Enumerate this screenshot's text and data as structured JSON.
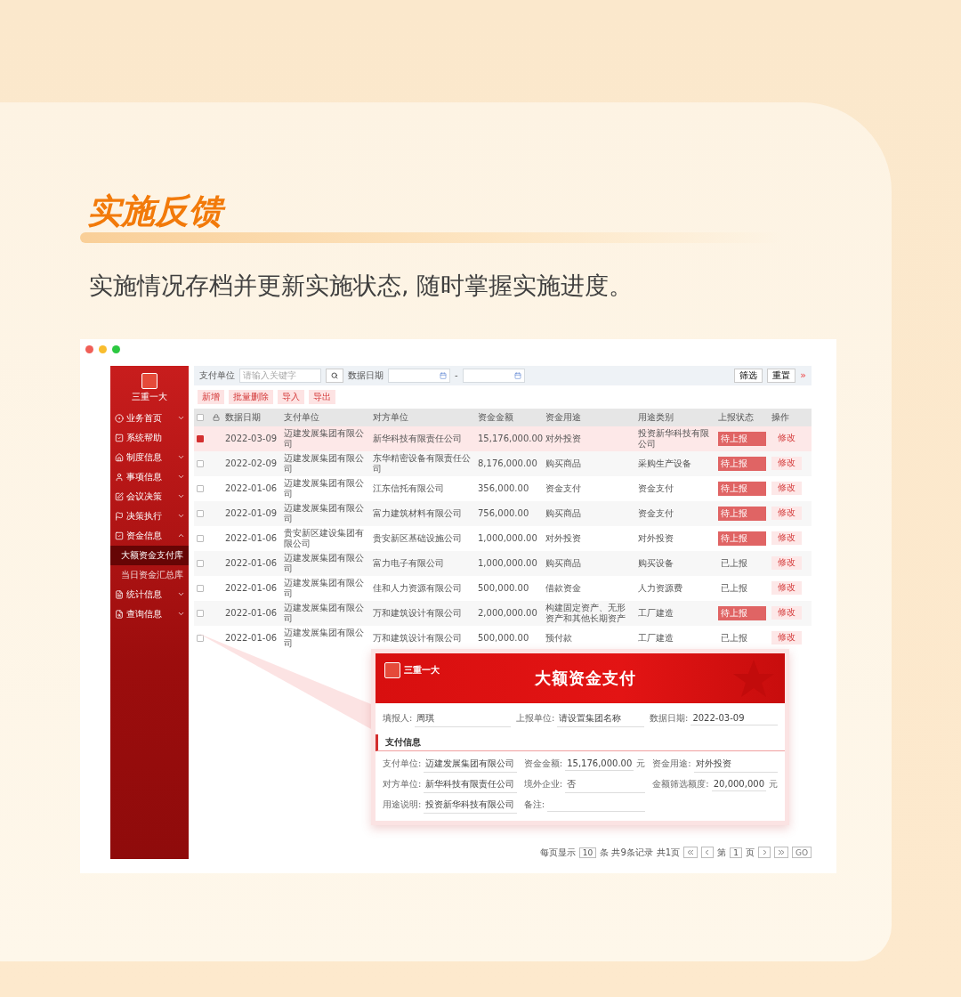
{
  "heading": "实施反馈",
  "description": "实施情况存档并更新实施状态, 随时掌握实施进度。",
  "app": {
    "logo": "三重一大",
    "sidebar": {
      "items": [
        {
          "label": "业务首页",
          "expanded": false,
          "selected": false
        },
        {
          "label": "系统帮助",
          "selected": false
        },
        {
          "label": "制度信息",
          "expanded": false,
          "selected": false
        },
        {
          "label": "事项信息",
          "expanded": false,
          "selected": false
        },
        {
          "label": "会议决策",
          "expanded": false,
          "selected": false
        },
        {
          "label": "决策执行",
          "expanded": false,
          "selected": false
        },
        {
          "label": "资金信息",
          "expanded": true,
          "selected": false,
          "children": [
            {
              "label": "大额资金支付库",
              "selected": true
            },
            {
              "label": "当日资金汇总库",
              "selected": false
            }
          ]
        },
        {
          "label": "统计信息",
          "expanded": false,
          "selected": false
        },
        {
          "label": "查询信息",
          "expanded": false,
          "selected": false
        }
      ]
    },
    "filters": {
      "payer_label": "支付单位",
      "payer_placeholder": "请输入关键字",
      "date_label": "数据日期",
      "date_separator": "-",
      "buttons": [
        "筛选",
        "重置"
      ],
      "more": "»"
    },
    "actions": [
      "新增",
      "批量删除",
      "导入",
      "导出"
    ],
    "table": {
      "header_checked": false,
      "columns": [
        "数据日期",
        "支付单位",
        "对方单位",
        "资金金额",
        "资金用途",
        "用途类别",
        "上报状态",
        "操作"
      ],
      "rows": [
        {
          "checked": true,
          "selected": true,
          "reported": false,
          "cells": [
            "2022-03-09",
            "迈建发展集团有限公司",
            "新华科技有限责任公司",
            "15,176,000.00",
            "对外投资",
            "投资新华科技有限公司",
            "待上报",
            "修改"
          ]
        },
        {
          "checked": false,
          "selected": false,
          "reported": false,
          "cells": [
            "2022-02-09",
            "迈建发展集团有限公司",
            "东华精密设备有限责任公司",
            "8,176,000.00",
            "购买商品",
            "采购生产设备",
            "待上报",
            "修改"
          ]
        },
        {
          "checked": false,
          "selected": false,
          "reported": false,
          "cells": [
            "2022-01-06",
            "迈建发展集团有限公司",
            "江东信托有限公司",
            "356,000.00",
            "资金支付",
            "资金支付",
            "待上报",
            "修改"
          ]
        },
        {
          "checked": false,
          "selected": false,
          "reported": false,
          "cells": [
            "2022-01-09",
            "迈建发展集团有限公司",
            "富力建筑材料有限公司",
            "756,000.00",
            "购买商品",
            "资金支付",
            "待上报",
            "修改"
          ]
        },
        {
          "checked": false,
          "selected": false,
          "reported": false,
          "cells": [
            "2022-01-06",
            "贵安新区建设集团有限公司",
            "贵安新区基础设施公司",
            "1,000,000.00",
            "对外投资",
            "对外投资",
            "待上报",
            "修改"
          ]
        },
        {
          "checked": false,
          "selected": false,
          "reported": true,
          "cells": [
            "2022-01-06",
            "迈建发展集团有限公司",
            "富力电子有限公司",
            "1,000,000.00",
            "购买商品",
            "购买设备",
            "已上报",
            "修改"
          ]
        },
        {
          "checked": false,
          "selected": false,
          "reported": true,
          "cells": [
            "2022-01-06",
            "迈建发展集团有限公司",
            "佳和人力资源有限公司",
            "500,000.00",
            "借款资金",
            "人力资源费",
            "已上报",
            "修改"
          ]
        },
        {
          "checked": false,
          "selected": false,
          "reported": false,
          "cells": [
            "2022-01-06",
            "迈建发展集团有限公司",
            "万和建筑设计有限公司",
            "2,000,000.00",
            "构建固定资产、无形资产和其他长期资产",
            "工厂建造",
            "待上报",
            "修改"
          ]
        },
        {
          "checked": false,
          "selected": false,
          "reported": true,
          "cells": [
            "2022-01-06",
            "迈建发展集团有限公司",
            "万和建筑设计有限公司",
            "500,000.00",
            "预付款",
            "工厂建造",
            "已上报",
            "修改"
          ]
        }
      ]
    },
    "pagination": {
      "per_page_label": "每页显示",
      "per_page": "10",
      "total": "条 共9条记录",
      "pages": "共1页",
      "page_prefix": "第",
      "page": "1",
      "page_suffix": "页",
      "go": "GO"
    },
    "detail": {
      "logo": "三重一大",
      "title": "大额资金支付",
      "top_fields": [
        {
          "label": "填报人:",
          "value": "周琪"
        },
        {
          "label": "上报单位:",
          "value": "请设置集团名称"
        },
        {
          "label": "数据日期:",
          "value": "2022-03-09"
        }
      ],
      "section": "支付信息",
      "fields": [
        {
          "label": "支付单位:",
          "value": "迈建发展集团有限公司"
        },
        {
          "label": "资金金额:",
          "value": "15,176,000.00",
          "unit": "元"
        },
        {
          "label": "资金用途:",
          "value": "对外投资"
        },
        {
          "label": "对方单位:",
          "value": "新华科技有限责任公司"
        },
        {
          "label": "境外企业:",
          "value": "否"
        },
        {
          "label": "金额筛选额度:",
          "value": "20,000,000",
          "unit": "元"
        },
        {
          "label": "用途说明:",
          "value": "投资新华科技有限公司"
        },
        {
          "label": "备注:"
        }
      ]
    }
  }
}
